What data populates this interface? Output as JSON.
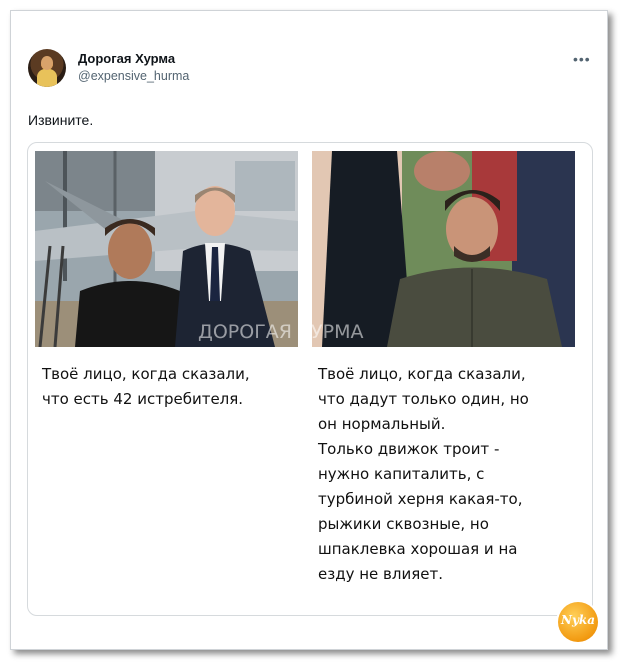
{
  "tweet": {
    "author_name": "Дорогая Хурма",
    "author_handle": "@expensive_hurma",
    "more_icon": "more-horizontal-icon",
    "text": "Извините."
  },
  "media": {
    "watermark": "ДОРОГАЯ ХУРМА",
    "left_caption_lines": [
      "Твоё лицо, когда сказали,",
      "что есть 42 истребителя."
    ],
    "right_caption_lines": [
      "Твоё лицо, когда сказали,",
      "что дадут только один, но",
      "он нормальный.",
      "Только движок троит -",
      "нужно капиталить, с",
      "турбиной херня какая-то,",
      "рыжики сквозные, но",
      "шпаклевка хорошая и на",
      "езду не влияет."
    ]
  },
  "logo_text": "Nyka"
}
